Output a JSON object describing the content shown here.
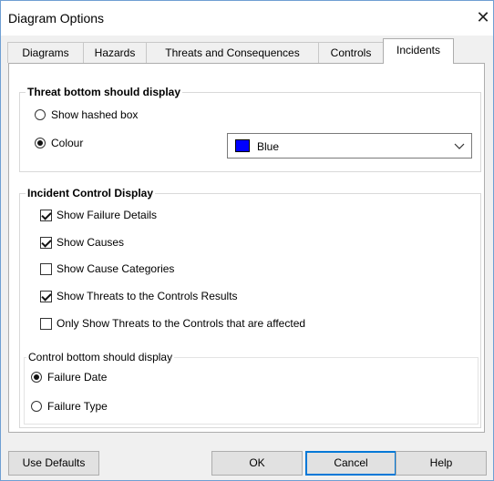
{
  "window": {
    "title": "Diagram Options",
    "close_icon": "close-icon",
    "close_glyph": "✕"
  },
  "tabs": [
    {
      "label": "Diagrams",
      "active": false
    },
    {
      "label": "Hazards",
      "active": false
    },
    {
      "label": "Threats and Consequences",
      "active": false
    },
    {
      "label": "Controls",
      "active": false
    },
    {
      "label": "Incidents",
      "active": true
    }
  ],
  "threat_bottom": {
    "legend": "Threat bottom should display",
    "options": [
      {
        "label": "Show hashed box",
        "selected": false
      },
      {
        "label": "Colour",
        "selected": true
      }
    ],
    "colour_select": {
      "value": "Blue",
      "swatch": "#0000ff"
    }
  },
  "incident_control": {
    "legend": "Incident Control Display",
    "checkboxes": [
      {
        "label": "Show Failure Details",
        "checked": true
      },
      {
        "label": "Show Causes",
        "checked": true
      },
      {
        "label": "Show Cause Categories",
        "checked": false
      },
      {
        "label": "Show Threats to the Controls Results",
        "checked": true
      },
      {
        "label": "Only Show Threats to the Controls that are affected",
        "checked": false
      }
    ]
  },
  "control_bottom": {
    "legend": "Control bottom should display",
    "options": [
      {
        "label": "Failure Date",
        "selected": true
      },
      {
        "label": "Failure Type",
        "selected": false
      }
    ]
  },
  "buttons": {
    "use_defaults": "Use Defaults",
    "ok": "OK",
    "cancel": "Cancel",
    "help": "Help"
  },
  "colors": {
    "accent": "#0078d7",
    "window_border": "#6f9fd3",
    "face": "#f0f0f0"
  }
}
